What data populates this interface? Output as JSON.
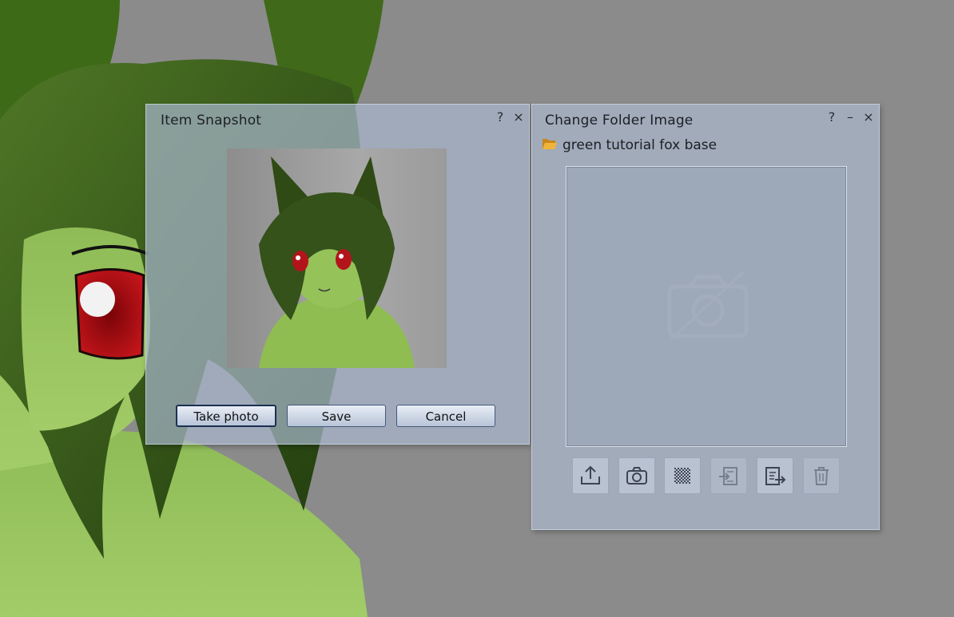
{
  "snapshot": {
    "title": "Item Snapshot",
    "help_label": "?",
    "close_label": "×",
    "buttons": {
      "take_photo": "Take photo",
      "save": "Save",
      "cancel": "Cancel"
    }
  },
  "folder_image": {
    "title": "Change Folder Image",
    "help_label": "?",
    "minimize_label": "–",
    "close_label": "×",
    "folder_name": "green tutorial fox base",
    "toolbar": [
      {
        "icon": "upload-icon",
        "enabled": true
      },
      {
        "icon": "camera-icon",
        "enabled": true
      },
      {
        "icon": "checker-icon",
        "enabled": true
      },
      {
        "icon": "paste-from-clipboard-icon",
        "enabled": false
      },
      {
        "icon": "copy-to-clipboard-icon",
        "enabled": true
      },
      {
        "icon": "trash-icon",
        "enabled": false
      }
    ]
  },
  "colors": {
    "avatar_skin": "#9ec766",
    "avatar_hair": "#3a5a1a",
    "avatar_eye": "#a80f14",
    "floater_bg": "#acbad0"
  }
}
